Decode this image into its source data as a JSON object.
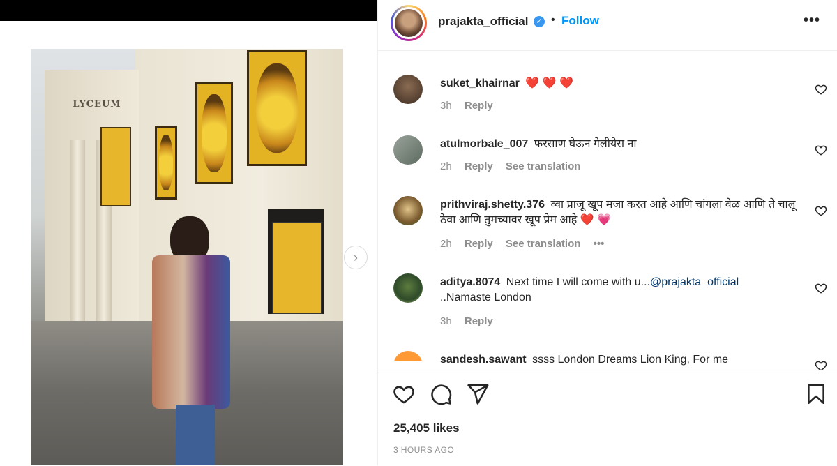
{
  "post": {
    "username": "prajakta_official",
    "follow_label": "Follow",
    "separator": "•",
    "more_label": "•••",
    "verified_mark": "✓",
    "likes": "25,405 likes",
    "time_ago": "3 HOURS AGO"
  },
  "photo": {
    "lyceum_text": "LYCEUM"
  },
  "comments": [
    {
      "user": "suket_khairnar",
      "text": "❤️ ❤️ ❤️",
      "time": "3h",
      "reply": "Reply",
      "see_translation": "",
      "more": ""
    },
    {
      "user": "atulmorbale_007",
      "text": "फरसाण घेऊन गेलीयेस ना",
      "time": "2h",
      "reply": "Reply",
      "see_translation": "See translation",
      "more": ""
    },
    {
      "user": "prithviraj.shetty.376",
      "text": "व्वा प्राजू खूप मजा करत आहे आणि चांगला वेळ आणि ते चालू ठेवा आणि तुमच्यावर खूप प्रेम आहे ❤️ 💗",
      "time": "2h",
      "reply": "Reply",
      "see_translation": "See translation",
      "more": "•••"
    },
    {
      "user": "aditya.8074",
      "text": "Next time I will come with u...",
      "mention": "@prajakta_official",
      "text2": "..Namaste London",
      "time": "3h",
      "reply": "Reply",
      "see_translation": "",
      "more": ""
    },
    {
      "user": "sandesh.sawant",
      "text": "ssss London Dreams Lion King, For me",
      "time": "",
      "reply": "",
      "see_translation": "",
      "more": ""
    }
  ],
  "icons": {
    "like": "heart-icon",
    "comment": "comment-icon",
    "share": "paper-plane-icon",
    "save": "bookmark-icon",
    "next": "chevron-right-icon",
    "next_glyph": "›"
  },
  "colors": {
    "follow_blue": "#0095f6",
    "verified_blue": "#3897f0",
    "heart_red": "#ed4956",
    "meta_gray": "#8e8e8e"
  }
}
